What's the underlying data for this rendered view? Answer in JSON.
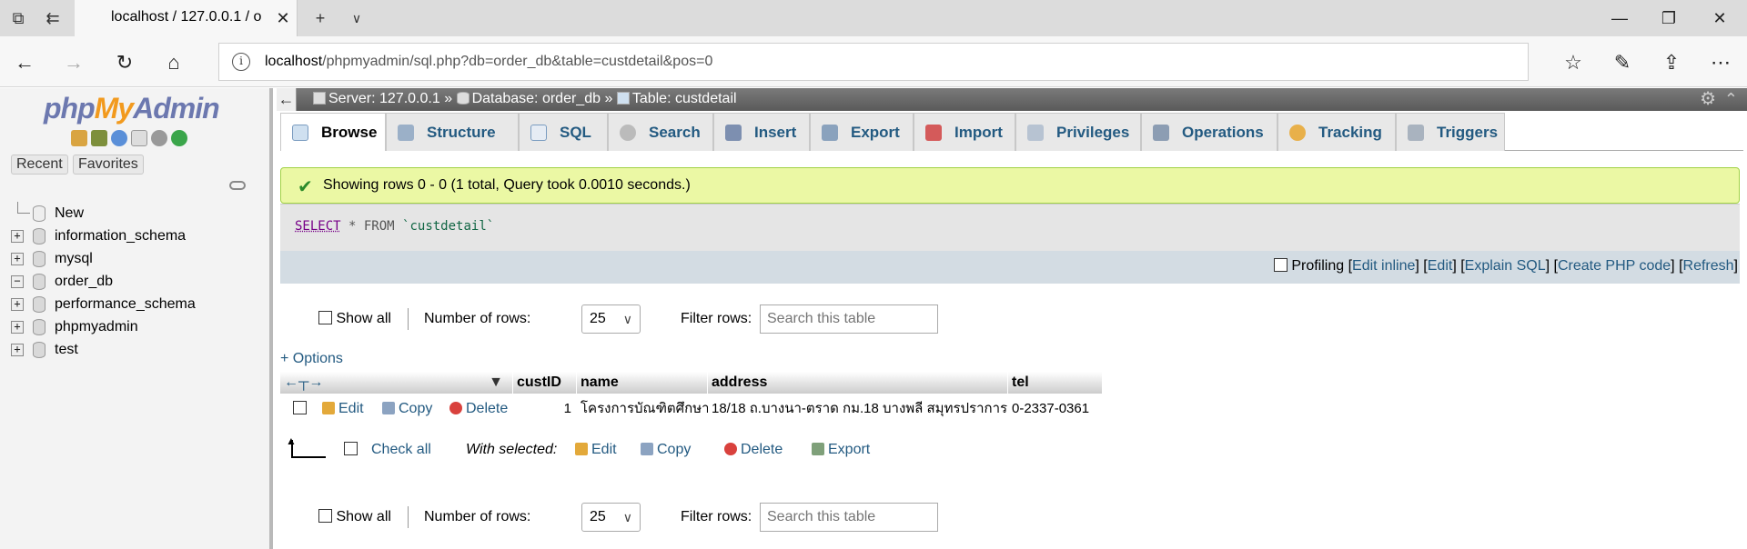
{
  "browser": {
    "tab_title": "localhost / 127.0.0.1 / o",
    "url_host": "localhost",
    "url_path": "/phpmyadmin/sql.php?db=order_db&table=custdetail&pos=0"
  },
  "sidebar": {
    "logo_php": "php",
    "logo_my": "My",
    "logo_admin": "Admin",
    "recent": "Recent",
    "favorites": "Favorites",
    "tree": [
      {
        "label": "New",
        "expander": ""
      },
      {
        "label": "information_schema",
        "expander": "+"
      },
      {
        "label": "mysql",
        "expander": "+"
      },
      {
        "label": "order_db",
        "expander": "−"
      },
      {
        "label": "performance_schema",
        "expander": "+"
      },
      {
        "label": "phpmyadmin",
        "expander": "+"
      },
      {
        "label": "test",
        "expander": "+"
      }
    ]
  },
  "breadcrumb": {
    "server": "Server: 127.0.0.1",
    "database": "Database: order_db",
    "table": "Table: custdetail",
    "sep": "»"
  },
  "tabs": [
    "Browse",
    "Structure",
    "SQL",
    "Search",
    "Insert",
    "Export",
    "Import",
    "Privileges",
    "Operations",
    "Tracking",
    "Triggers"
  ],
  "message": "Showing rows 0 - 0 (1 total, Query took 0.0010 seconds.)",
  "sql": {
    "select": "SELECT",
    "middle": "* FROM",
    "table": "`custdetail`"
  },
  "sql_actions": {
    "profiling": "Profiling",
    "edit_inline": "Edit inline",
    "edit": "Edit",
    "explain": "Explain SQL",
    "create_php": "Create PHP code",
    "refresh": "Refresh"
  },
  "nav_rows": {
    "show_all": "Show all",
    "num_rows_label": "Number of rows:",
    "num_rows_value": "25",
    "filter_label": "Filter rows:",
    "filter_placeholder": "Search this table"
  },
  "options_link": "+ Options",
  "table": {
    "columns": [
      "custID",
      "name",
      "address",
      "tel"
    ],
    "rows": [
      {
        "actions": {
          "edit": "Edit",
          "copy": "Copy",
          "delete": "Delete"
        },
        "custID": "1",
        "name": "โครงการบัณฑิตศึกษา",
        "address": "18/18 ถ.บางนา-ตราด กม.18 บางพลี สมุทรปราการ",
        "tel": "0-2337-0361"
      }
    ]
  },
  "with_selected": {
    "check_all": "Check all",
    "label": "With selected:",
    "edit": "Edit",
    "copy": "Copy",
    "delete": "Delete",
    "export": "Export"
  }
}
